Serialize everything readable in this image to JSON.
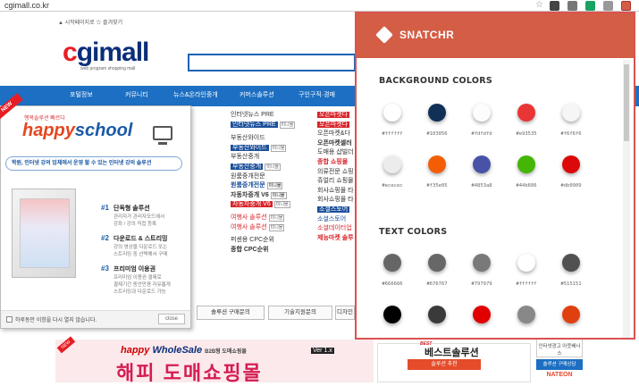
{
  "browser": {
    "url": "cgimall.co.kr"
  },
  "site": {
    "toplinks": "▲ 시작페이지로   ☆ 즐겨찾기",
    "logo_prefix": "c",
    "logo_rest": "gimall",
    "logo_sub": "web program shopping mall",
    "nav": [
      "포털정보",
      "커뮤니티",
      "뉴스&온라인중개",
      "커머스솔루션",
      "구인구직·경매"
    ]
  },
  "happyschool": {
    "badge": "NEW",
    "pre": "행복솔루션 빠르다",
    "logo_a": "happy",
    "logo_b": "school",
    "tagline": "학원, 인터넷 강의 업체에서 운영 할 수 있는 인터넷 강의 솔루션",
    "features": [
      {
        "num": "#1",
        "title": "단독형 솔루션",
        "desc": "관리자가 관리자모드에서\n강좌 / 강의 직접 등록"
      },
      {
        "num": "#2",
        "title": "다운로드 & 스트리밍",
        "desc": "강의 영상을 다운로드 또는\n스트리밍 중 선택해서 구매"
      },
      {
        "num": "#3",
        "title": "프리미엄 이용권",
        "desc": "프리미엄 이용권 결제로\n결제기간 동안만큼 자유롭게\n스트리밍과 다운로드 가능"
      }
    ],
    "footer_checkbox": "하루동안 이창을 다시 열지 않습니다.",
    "close": "close"
  },
  "middle": {
    "col1": [
      "인터넷뉴스 PRE",
      "인터넷뉴스 PRE",
      "부동산와이드",
      "부동산와이드",
      "부동산중개",
      "부동산중개",
      "원룸중개전문",
      "원룸중개전문",
      "자동차중개 V6",
      "자동차중개 V6",
      "",
      "여행사 솔루션",
      "여행사 솔루션",
      "",
      "퍼센용 CPC순위",
      "종합 CPC순위"
    ],
    "col2": [
      "오픈마켓다",
      "오픈마켓다",
      "오픈마켓&다",
      "오픈마켓셀러",
      "도매용 샵빌더",
      "종합 쇼핑몰",
      "의류전문 쇼핑",
      "쥬얼리 쇼핑몰",
      "회사쇼핑몰 타",
      "회사쇼핑몰 타",
      "소셜스토어",
      "소셜스토어",
      "소셜데이터업",
      "제능마켓 솔루"
    ],
    "mini": "미니몰"
  },
  "bottom": {
    "buttons": [
      "솔루션 구매문의",
      "기술지원문의",
      "디자인"
    ],
    "ws_title_a": "happy",
    "ws_title_b": "WholeSale",
    "ws_sub": "B2B형 도매쇼핑몰",
    "ws_ver": "Ver 1.x",
    "ws_big": "해피 도매쇼핑몰",
    "best_pre": "BEST",
    "best": "베스트솔루션",
    "best_bar": "솔루션 추천",
    "side1": "인터넷광고 아웃배너스",
    "side2": "솔루션 구매상담",
    "side3": "NATEON"
  },
  "snatchr": {
    "title": "SNATCHR",
    "bg_heading": "BACKGROUND COLORS",
    "text_heading": "TEXT COLORS",
    "background_colors": [
      "#ffffff",
      "#103056",
      "#fdfdfd",
      "#e93535",
      "#f6f6f6",
      "#ececec",
      "#f35e05",
      "#4853a8",
      "#44b606",
      "#db0909"
    ],
    "text_colors": [
      "#666666",
      "#676767",
      "#797979",
      "#ffffff",
      "#515151",
      "#000000",
      "#3a3a3a",
      "#e00000",
      "#888888",
      "#e04010"
    ],
    "bg_labels": [
      "#ffffff",
      "#103056",
      "#fdfdfd",
      "#e93535",
      "#f6f6f6",
      "#ececec",
      "#f35e05",
      "#4853a8",
      "#44b606",
      "#db0909"
    ],
    "text_labels": [
      "#666666",
      "#676767",
      "#797979",
      "#ffffff",
      "#515151"
    ]
  }
}
